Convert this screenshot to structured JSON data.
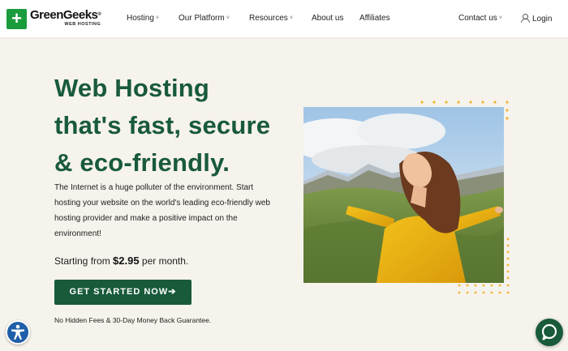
{
  "header": {
    "logo": {
      "name": "GreenGeeks",
      "registered": "®",
      "subtitle": "WEB HOSTING",
      "mark": "+"
    },
    "nav": [
      {
        "label": "Hosting",
        "dropdown": true
      },
      {
        "label": "Our Platform",
        "dropdown": true
      },
      {
        "label": "Resources",
        "dropdown": true
      },
      {
        "label": "About us",
        "dropdown": false
      },
      {
        "label": "Affiliates",
        "dropdown": false
      },
      {
        "label": "Contact us",
        "dropdown": true
      },
      {
        "label": "Login",
        "icon": "user-icon"
      }
    ],
    "chevron": "˅"
  },
  "hero": {
    "title_line1": "Web Hosting",
    "title_line2": "that's fast, secure",
    "title_line3": "& eco-friendly.",
    "description": "The Internet is a huge polluter of the environment. Start hosting your website on the world's leading eco-friendly web hosting provider and make a positive impact on the environment!",
    "price_prefix": "Starting from ",
    "price": "$2.95",
    "price_suffix": " per month.",
    "cta_label": "GET STARTED NOW",
    "cta_arrow": "➔",
    "guarantee": "No Hidden Fees & 30-Day Money Back Guarantee."
  },
  "colors": {
    "brand_green": "#185a3a",
    "logo_green": "#1a9b3c",
    "background": "#f6f2ec",
    "accent_dots": "#f2b632",
    "accessibility_blue": "#1f5ea8"
  },
  "widgets": {
    "accessibility_icon": "accessibility-icon",
    "chat_icon": "chat-bubble-icon"
  }
}
